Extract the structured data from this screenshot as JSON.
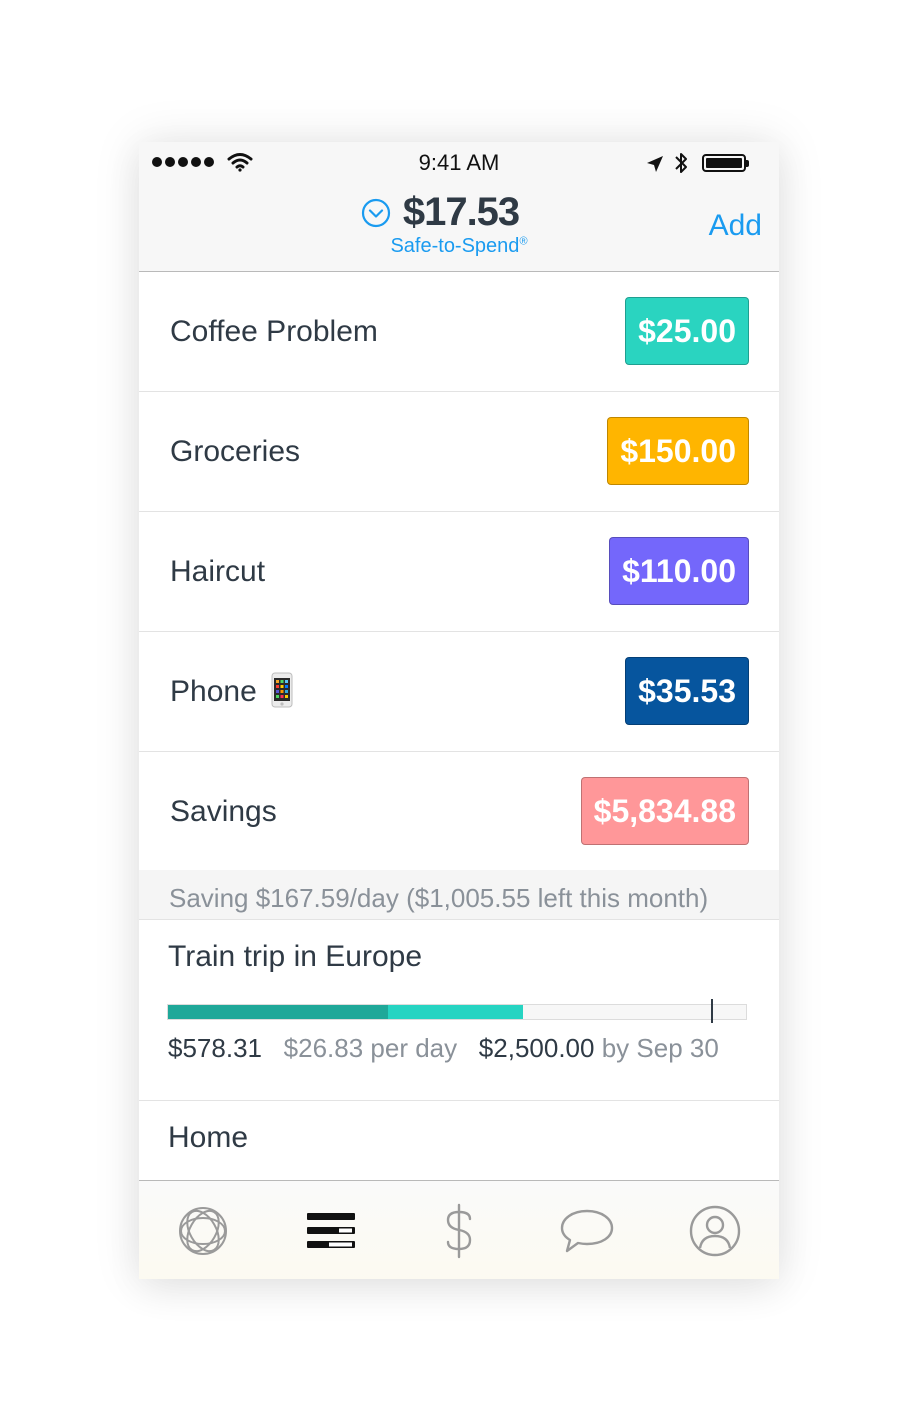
{
  "status_bar": {
    "time": "9:41 AM"
  },
  "header": {
    "safe_to_spend_amount": "$17.53",
    "safe_to_spend_label": "Safe-to-Spend",
    "registered_mark": "®",
    "add_label": "Add",
    "icons": [
      "chevron-down-circle-icon"
    ]
  },
  "envelopes": [
    {
      "name": "Coffee Problem",
      "amount": "$25.00",
      "color": "#2ad4c0"
    },
    {
      "name": "Groceries",
      "amount": "$150.00",
      "color": "#ffb500"
    },
    {
      "name": "Haircut",
      "amount": "$110.00",
      "color": "#7467fb"
    },
    {
      "name": "Phone",
      "emoji": "phone-emoji-icon",
      "amount": "$35.53",
      "color": "#06559e"
    },
    {
      "name": "Savings",
      "amount": "$5,834.88",
      "color": "#ff9799"
    }
  ],
  "savings_summary": "Saving $167.59/day ($1,005.55 left this month)",
  "goals": [
    {
      "name": "Train trip in Europe",
      "saved": "$578.31",
      "per_day": "$26.83 per day",
      "target": "$2,500.00",
      "by_date": "by Sep 30",
      "progress": {
        "saved_fraction": 0.38,
        "with_today_fraction": 0.614,
        "expected_fraction": 0.94
      },
      "colors": {
        "saved": "#1fa899",
        "today": "#26d4c2"
      }
    },
    {
      "name": "Home"
    }
  ],
  "tab_bar": {
    "tabs": [
      "home-logo-icon",
      "envelopes-icon",
      "dollar-icon",
      "chat-bubble-icon",
      "profile-icon"
    ],
    "active": "envelopes-icon"
  }
}
